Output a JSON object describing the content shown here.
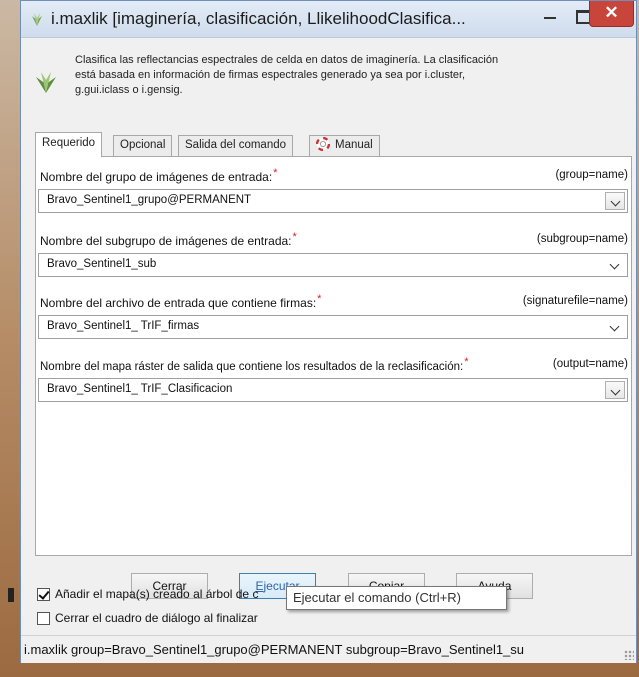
{
  "window": {
    "title": "i.maxlik [imaginería, clasificación, LlikelihoodClasifica...",
    "close_label": "✕"
  },
  "description": "Clasifica las reflectancias espectrales de celda en datos de imaginería. La clasificación está basada en información de firmas espectrales generado ya sea por i.cluster, g.gui.iclass o i.gensig.",
  "tabs": [
    {
      "label": "Requerido",
      "active": true
    },
    {
      "label": "Opcional",
      "active": false
    },
    {
      "label": "Salida del comando",
      "active": false
    },
    {
      "label": "Manual",
      "active": false
    }
  ],
  "fields": [
    {
      "label": "Nombre del grupo de imágenes de entrada:",
      "param": "(group=name)",
      "value": "Bravo_Sentinel1_grupo@PERMANENT"
    },
    {
      "label": "Nombre del subgrupo de imágenes de entrada:",
      "param": "(subgroup=name)",
      "value": "Bravo_Sentinel1_sub"
    },
    {
      "label": "Nombre del archivo de entrada que contiene firmas:",
      "param": "(signaturefile=name)",
      "value": "Bravo_Sentinel1_ TrIF_firmas"
    },
    {
      "label": "Nombre del mapa ráster de salida que contiene los resultados de la  reclasificación:",
      "param": "(output=name)",
      "value": "Bravo_Sentinel1_ TrIF_Clasificacion"
    }
  ],
  "required_mark": "*",
  "buttons": {
    "close": {
      "mnemonic": "",
      "rest": "Cerrar"
    },
    "run": {
      "mnemonic": "E",
      "rest": "jecutar"
    },
    "copy": {
      "mnemonic": "C",
      "rest": "opiar"
    },
    "help": {
      "mnemonic": "A",
      "rest": "yuda"
    }
  },
  "checkboxes": {
    "add_map": {
      "label": "Añadir el mapa(s) creado al árbol de c",
      "checked": true
    },
    "close_on_finish": {
      "label": "Cerrar el cuadro de diálogo al finalizar",
      "checked": false
    }
  },
  "tooltip": "Ejecutar el comando (Ctrl+R)",
  "command_line": "i.maxlik group=Bravo_Sentinel1_grupo@PERMANENT subgroup=Bravo_Sentinel1_su",
  "colors": {
    "close_button": "#c7453a",
    "required": "#e02020",
    "primary_border": "#3c7fb1"
  },
  "icons": [
    "grass-app-icon",
    "grass-module-icon",
    "lifebuoy-icon",
    "chevron-down-icon",
    "resize-grip-icon"
  ]
}
